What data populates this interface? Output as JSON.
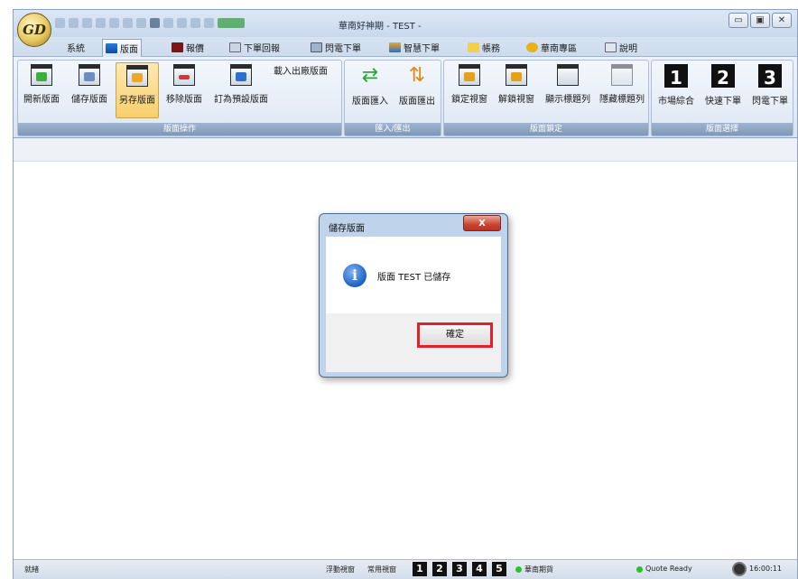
{
  "window": {
    "title": "華南好神期 - TEST -"
  },
  "menu": {
    "tabs": [
      {
        "label": "系統",
        "icon": "none"
      },
      {
        "label": "版面",
        "icon": "layout-icon"
      },
      {
        "label": "報價",
        "icon": "quote-icon"
      },
      {
        "label": "下單回報",
        "icon": "report-icon"
      },
      {
        "label": "閃電下單",
        "icon": "lightning-order-icon"
      },
      {
        "label": "智慧下單",
        "icon": "smart-order-icon"
      },
      {
        "label": "帳務",
        "icon": "account-icon"
      },
      {
        "label": "華南專區",
        "icon": "hua-nan-zone-icon"
      },
      {
        "label": "說明",
        "icon": "help-icon"
      }
    ],
    "active_index": 1
  },
  "ribbon": {
    "layout_ops": {
      "buttons": [
        "開新版面",
        "儲存版面",
        "另存版面",
        "移除版面",
        "訂為預設版面"
      ],
      "extra": "載入出廠版面",
      "label": "版面操作"
    },
    "import_export": {
      "buttons": [
        "版面匯入",
        "版面匯出"
      ],
      "label": "匯入/匯出"
    },
    "layout_lock": {
      "buttons": [
        "鎖定視窗",
        "解鎖視窗",
        "顯示標題列",
        "隱藏標題列"
      ],
      "label": "版面鎖定"
    },
    "layout_select": {
      "buttons": [
        {
          "num": "1",
          "label": "市場綜合"
        },
        {
          "num": "2",
          "label": "快速下單"
        },
        {
          "num": "3",
          "label": "閃電下單"
        }
      ],
      "label": "版面選擇"
    }
  },
  "dialog": {
    "title": "儲存版面",
    "close": "X",
    "message": "版面 TEST 已儲存",
    "ok": "確定"
  },
  "statusbar": {
    "left": "就緒",
    "float_window": "浮動視窗",
    "layout_window": "常用視窗",
    "nums": [
      "1",
      "2",
      "3",
      "4",
      "5"
    ],
    "connection": "華南期貨",
    "quote": "Quote Ready",
    "time": "16:00:11"
  },
  "colors": {
    "accent": "#e0202a",
    "ribbon_label": "#7f98b9",
    "status_green": "#2ec02e"
  }
}
